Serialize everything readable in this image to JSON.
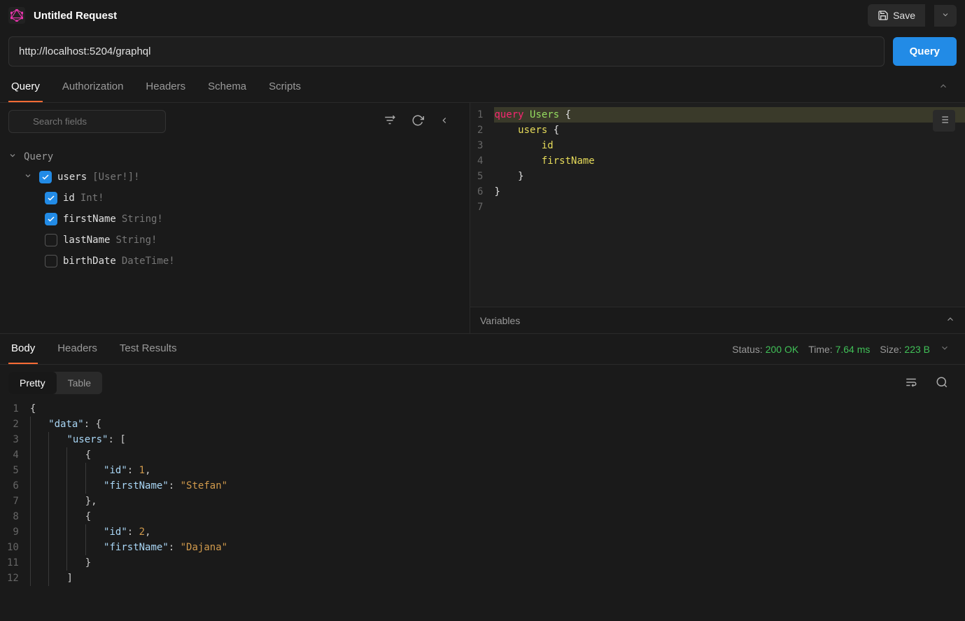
{
  "header": {
    "title": "Untitled Request",
    "save_label": "Save"
  },
  "url": "http://localhost:5204/graphql",
  "query_button": "Query",
  "tabs": [
    "Query",
    "Authorization",
    "Headers",
    "Schema",
    "Scripts"
  ],
  "active_tab": "Query",
  "schema": {
    "search_placeholder": "Search fields",
    "root_label": "Query",
    "users_field": {
      "name": "users",
      "type": "[User!]!",
      "checked": true
    },
    "fields": [
      {
        "name": "id",
        "type": "Int!",
        "checked": true
      },
      {
        "name": "firstName",
        "type": "String!",
        "checked": true
      },
      {
        "name": "lastName",
        "type": "String!",
        "checked": false
      },
      {
        "name": "birthDate",
        "type": "DateTime!",
        "checked": false
      }
    ]
  },
  "editor": {
    "lines": [
      [
        [
          "kw",
          "query"
        ],
        [
          "sp",
          " "
        ],
        [
          "name",
          "Users"
        ],
        [
          "sp",
          " "
        ],
        [
          "brace",
          "{"
        ]
      ],
      [
        [
          "sp",
          "    "
        ],
        [
          "field",
          "users"
        ],
        [
          "sp",
          " "
        ],
        [
          "brace",
          "{"
        ]
      ],
      [
        [
          "sp",
          "        "
        ],
        [
          "field",
          "id"
        ]
      ],
      [
        [
          "sp",
          "        "
        ],
        [
          "field",
          "firstName"
        ]
      ],
      [
        [
          "sp",
          "    "
        ],
        [
          "brace",
          "}"
        ]
      ],
      [
        [
          "brace",
          "}"
        ]
      ],
      []
    ],
    "highlight_line": 0
  },
  "variables_label": "Variables",
  "response": {
    "tabs": [
      "Body",
      "Headers",
      "Test Results"
    ],
    "active_tab": "Body",
    "status": {
      "label": "Status:",
      "value": "200 OK"
    },
    "time": {
      "label": "Time:",
      "value": "7.64 ms"
    },
    "size": {
      "label": "Size:",
      "value": "223 B"
    },
    "views": [
      "Pretty",
      "Table"
    ],
    "active_view": "Pretty",
    "body_lines": [
      "{",
      "    \"data\": {",
      "        \"users\": [",
      "            {",
      "                \"id\": 1,",
      "                \"firstName\": \"Stefan\"",
      "            },",
      "            {",
      "                \"id\": 2,",
      "                \"firstName\": \"Dajana\"",
      "            }",
      "        ]"
    ],
    "json_data": {
      "data": {
        "users": [
          {
            "id": 1,
            "firstName": "Stefan"
          },
          {
            "id": 2,
            "firstName": "Dajana"
          }
        ]
      }
    }
  }
}
